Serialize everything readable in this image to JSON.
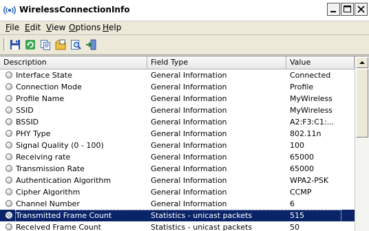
{
  "window": {
    "title": "WirelessConnectionInfo"
  },
  "icons": {
    "app": "wifi-app-icon",
    "toolbar": [
      "save-icon",
      "refresh-icon",
      "copy-icon",
      "properties-icon",
      "find-icon",
      "exit-icon"
    ]
  },
  "menu": {
    "items": [
      {
        "label": "File",
        "mnemonic": "F"
      },
      {
        "label": "Edit",
        "mnemonic": "E"
      },
      {
        "label": "View",
        "mnemonic": "V"
      },
      {
        "label": "Options",
        "mnemonic": "O"
      },
      {
        "label": "Help",
        "mnemonic": "H"
      }
    ]
  },
  "list": {
    "columns": [
      "Description",
      "Field Type",
      "Value"
    ],
    "selected_index": 12,
    "rows": [
      [
        "Interface State",
        "General Information",
        "Connected"
      ],
      [
        "Connection Mode",
        "General Information",
        "Profile"
      ],
      [
        "Profile Name",
        "General Information",
        "MyWireless"
      ],
      [
        "SSID",
        "General Information",
        "MyWireless"
      ],
      [
        "BSSID",
        "General Information",
        "A2:F3:C1:..."
      ],
      [
        "PHY Type",
        "General Information",
        "802.11n"
      ],
      [
        "Signal Quality (0 - 100)",
        "General Information",
        "100"
      ],
      [
        "Receiving rate",
        "General Information",
        "65000"
      ],
      [
        "Transmission Rate",
        "General Information",
        "65000"
      ],
      [
        "Authentication Algorithm",
        "General Information",
        "WPA2-PSK"
      ],
      [
        "Cipher Algorithm",
        "General Information",
        "CCMP"
      ],
      [
        "Channel Number",
        "General Information",
        "6"
      ],
      [
        "Transmitted Frame Count",
        "Statistics - unicast packets",
        "515"
      ],
      [
        "Received Frame Count",
        "Statistics - unicast packets",
        "50"
      ]
    ]
  },
  "colors": {
    "selection": "#0a246a",
    "window_bg": "#ece9d8"
  }
}
